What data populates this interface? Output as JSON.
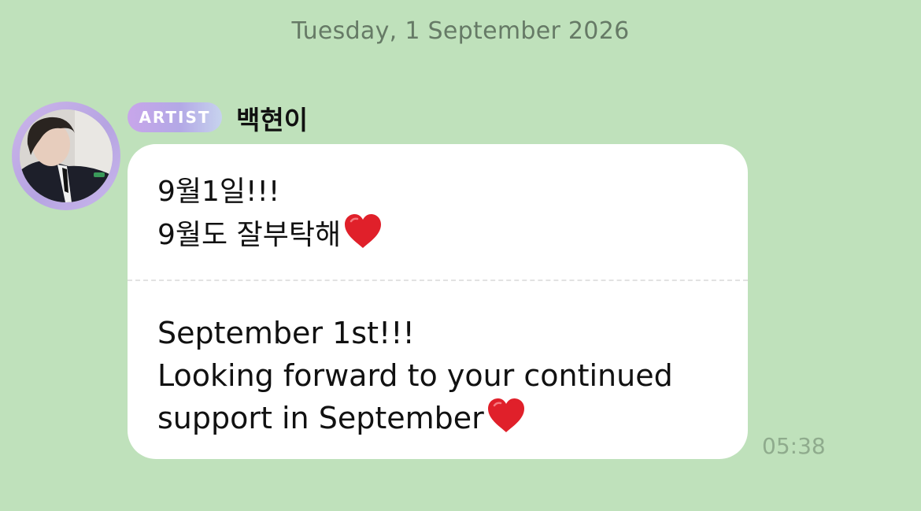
{
  "date_separator": "Tuesday, 1 September 2026",
  "sender": {
    "badge": "ARTIST",
    "name": "백현이",
    "avatar_icon": "avatar-photo"
  },
  "message": {
    "original_lines": [
      "9월1일!!!",
      "9월도 잘부탁해"
    ],
    "translation_lines": [
      "September 1st!!!",
      "Looking forward to your continued",
      "support in September"
    ],
    "emoji": "heart-icon",
    "time": "05:38"
  },
  "colors": {
    "background": "#bfe1bb",
    "bubble": "#ffffff",
    "badge_start": "#c8a6ea",
    "badge_end": "#c7d3ee",
    "heart": "#e0202a",
    "timestamp": "#8fab8d"
  }
}
